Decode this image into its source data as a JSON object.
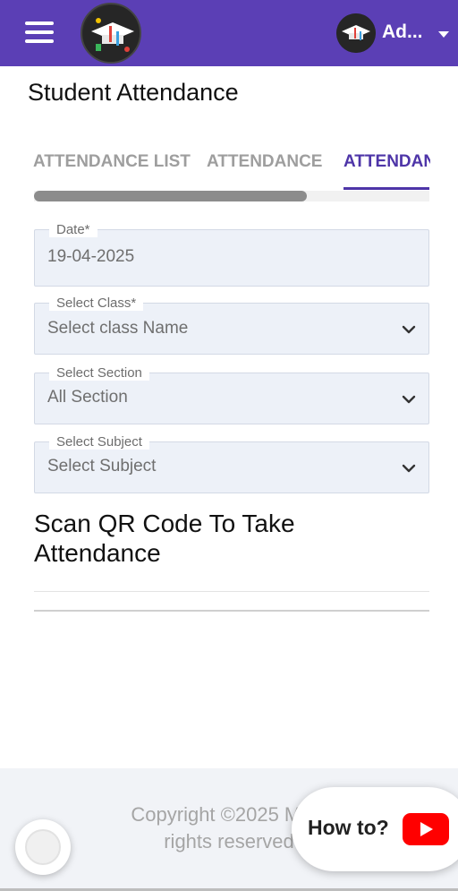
{
  "header": {
    "user_name": "Ad...",
    "brand_color": "#5b3fb5"
  },
  "page": {
    "title": "Student Attendance"
  },
  "tabs": [
    {
      "label": "ATTENDANCE LIST",
      "active": false
    },
    {
      "label": "ATTENDANCE",
      "active": false
    },
    {
      "label": "ATTENDAN",
      "active": true
    }
  ],
  "form": {
    "date": {
      "label": "Date*",
      "value": "19-04-2025"
    },
    "class": {
      "label": "Select Class*",
      "value": "Select class Name"
    },
    "section": {
      "label": "Select Section",
      "value": "All Section"
    },
    "subject": {
      "label": "Select Subject",
      "value": "Select Subject"
    }
  },
  "scan": {
    "title_line1": "Scan QR Code To Take",
    "title_line2": "Attendance"
  },
  "footer": {
    "line1": "Copyright ©2025 Mojo",
    "line2": "rights reserved"
  },
  "howto": {
    "label": "How to?"
  },
  "icons": {
    "menu": "hamburger-icon",
    "logo": "graduation-cap-logo",
    "avatar": "graduation-cap-avatar",
    "dropdown": "chevron-down-icon",
    "youtube": "youtube-play-icon"
  }
}
